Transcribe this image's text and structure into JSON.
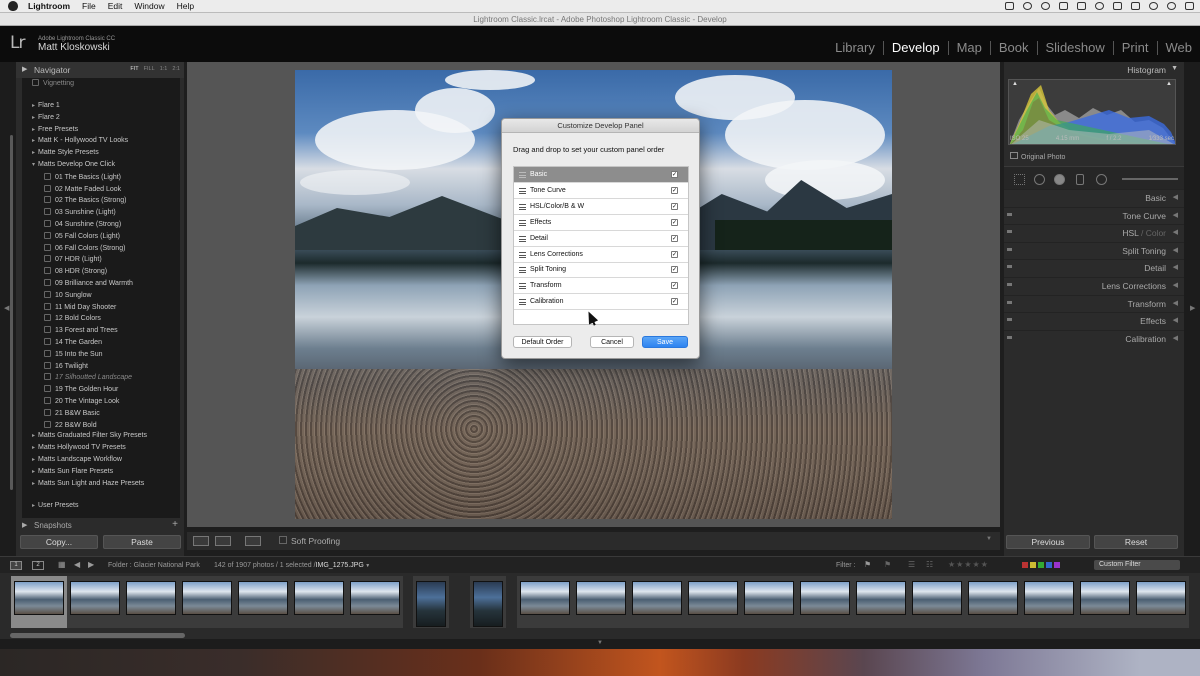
{
  "menubar": {
    "app_name": "Lightroom",
    "items": [
      "File",
      "Edit",
      "Window",
      "Help"
    ]
  },
  "window": {
    "title": "Lightroom Classic.lrcat - Adobe Photoshop Lightroom Classic - Develop"
  },
  "identity": {
    "logo": "Lr",
    "product": "Adobe Lightroom Classic CC",
    "user": "Matt Kloskowski"
  },
  "modules": {
    "items": [
      "Library",
      "Develop",
      "Map",
      "Book",
      "Slideshow",
      "Print",
      "Web"
    ],
    "active": "Develop"
  },
  "left_panel": {
    "navigator_label": "Navigator",
    "zoom_options": [
      "FIT",
      "FILL",
      "1:1",
      "2:1"
    ],
    "presets": [
      {
        "label": "Vignetting",
        "type": "item"
      },
      {
        "label": "Flare 1",
        "type": "folder"
      },
      {
        "label": "Flare 2",
        "type": "folder"
      },
      {
        "label": "Free Presets",
        "type": "folder"
      },
      {
        "label": "Matt K - Hollywood TV Looks",
        "type": "folder"
      },
      {
        "label": "Matte Style Presets",
        "type": "folder"
      },
      {
        "label": "Matts Develop One Click",
        "type": "folder-open"
      },
      {
        "label": "01 The Basics (Light)",
        "type": "item"
      },
      {
        "label": "02 Matte Faded Look",
        "type": "item"
      },
      {
        "label": "02 The Basics (Strong)",
        "type": "item"
      },
      {
        "label": "03 Sunshine (Light)",
        "type": "item"
      },
      {
        "label": "04 Sunshine (Strong)",
        "type": "item"
      },
      {
        "label": "05 Fall Colors (Light)",
        "type": "item"
      },
      {
        "label": "06 Fall Colors (Strong)",
        "type": "item"
      },
      {
        "label": "07 HDR (Light)",
        "type": "item"
      },
      {
        "label": "08 HDR (Strong)",
        "type": "item"
      },
      {
        "label": "09 Brilliance and Warmth",
        "type": "item"
      },
      {
        "label": "10 Sunglow",
        "type": "item"
      },
      {
        "label": "11 Mid Day Shooter",
        "type": "item"
      },
      {
        "label": "12 Bold Colors",
        "type": "item"
      },
      {
        "label": "13 Forest and Trees",
        "type": "item"
      },
      {
        "label": "14 The Garden",
        "type": "item"
      },
      {
        "label": "15 Into the Sun",
        "type": "item"
      },
      {
        "label": "16 Twilight",
        "type": "item"
      },
      {
        "label": "17 Silhoutted Landscape",
        "type": "item-dim"
      },
      {
        "label": "19 The Golden Hour",
        "type": "item"
      },
      {
        "label": "20 The Vintage Look",
        "type": "item"
      },
      {
        "label": "21 B&W Basic",
        "type": "item"
      },
      {
        "label": "22 B&W Bold",
        "type": "item"
      },
      {
        "label": "Matts Graduated Filter Sky Presets",
        "type": "folder"
      },
      {
        "label": "Matts Hollywood TV Presets",
        "type": "folder"
      },
      {
        "label": "Matts Landscape Workflow",
        "type": "folder"
      },
      {
        "label": "Matts Sun Flare Presets",
        "type": "folder"
      },
      {
        "label": "Matts Sun Light and Haze Presets",
        "type": "folder"
      },
      {
        "label": "User Presets",
        "type": "folder"
      }
    ],
    "snapshots_label": "Snapshots",
    "copy_label": "Copy...",
    "paste_label": "Paste"
  },
  "toolbar": {
    "soft_proofing_label": "Soft Proofing"
  },
  "right_panel": {
    "histogram_label": "Histogram",
    "meta": [
      "ISO 25",
      "4.15 mm",
      "f / 2.2",
      "1⁄333 sec"
    ],
    "original_photo_label": "Original Photo",
    "sections": [
      {
        "label": "Basic"
      },
      {
        "label": "Tone Curve"
      },
      {
        "label": "HSL / Color",
        "part1": "HSL",
        "part2": "Color"
      },
      {
        "label": "Split Toning"
      },
      {
        "label": "Detail"
      },
      {
        "label": "Lens Corrections"
      },
      {
        "label": "Transform"
      },
      {
        "label": "Effects"
      },
      {
        "label": "Calibration"
      }
    ],
    "previous_label": "Previous",
    "reset_label": "Reset"
  },
  "filmstrip": {
    "screen1": "1",
    "screen2": "2",
    "folder_text": "Folder : Glacier National Park",
    "count_text": "142 of 1907 photos / 1 selected /",
    "filename": "IMG_1275.JPG",
    "filter_label": "Filter :",
    "custom_filter_label": "Custom Filter"
  },
  "dialog": {
    "title": "Customize Develop Panel",
    "instruction": "Drag and drop to set your custom panel order",
    "rows": [
      {
        "label": "Basic",
        "checked": true,
        "header": true
      },
      {
        "label": "Tone Curve",
        "checked": true
      },
      {
        "label": "HSL/Color/B & W",
        "checked": true
      },
      {
        "label": "Effects",
        "checked": true
      },
      {
        "label": "Detail",
        "checked": true
      },
      {
        "label": "Lens Corrections",
        "checked": true
      },
      {
        "label": "Split Toning",
        "checked": true
      },
      {
        "label": "Transform",
        "checked": true
      },
      {
        "label": "Calibration",
        "checked": true
      }
    ],
    "default_order_label": "Default Order",
    "cancel_label": "Cancel",
    "save_label": "Save"
  },
  "colors": {
    "accent_blue": "#2e83f0",
    "panel_bg": "#2b2b2b",
    "active_module": "#ffffff"
  }
}
